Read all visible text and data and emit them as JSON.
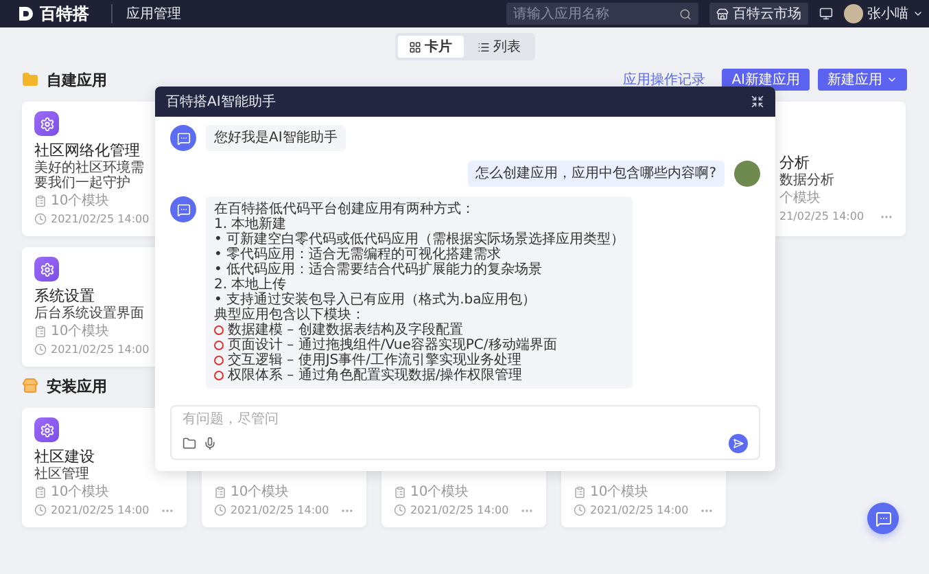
{
  "header": {
    "logo": "百特搭",
    "title": "应用管理",
    "search": {
      "placeholder": "请输入应用名称"
    },
    "market": "百特云市场",
    "user": "张小喵"
  },
  "view_toggle": [
    {
      "label": "卡片",
      "selected": true
    },
    {
      "label": "列表",
      "selected": false
    }
  ],
  "sections": [
    {
      "kind": "folder",
      "title": "自建应用",
      "actions": {
        "link": "应用操作记录",
        "ai_button": "AI新建应用",
        "new_button": "新建应用"
      },
      "cards": [
        {
          "kind": "full",
          "title": "社区网络化管理",
          "description": "美好的社区环境需要我们一起守护",
          "modules": "10个模块",
          "date": "2021/02/25 14:00"
        },
        {
          "kind": "covered"
        },
        {
          "kind": "covered"
        },
        {
          "kind": "covered"
        },
        {
          "kind": "right",
          "title": "分析",
          "description": "数据分析",
          "modules": "个模块",
          "date": "21/02/25 14:00"
        },
        {
          "kind": "full",
          "title": "系统设置",
          "description": "后台系统设置界面",
          "modules": "10个模块",
          "date": "2021/02/25 14:00"
        }
      ]
    },
    {
      "kind": "store",
      "title": "安装应用",
      "cards": [
        {
          "kind": "full",
          "title": "社区建设",
          "description": "社区管理",
          "modules": "10个模块",
          "date": "2021/02/25 14:00"
        },
        {
          "kind": "bottom",
          "modules": "10个模块",
          "date": "2021/02/25 14:00"
        },
        {
          "kind": "bottom",
          "modules": "10个模块",
          "date": "2021/02/25 14:00"
        },
        {
          "kind": "bottom",
          "modules": "10个模块",
          "date": "2021/02/25 14:00"
        }
      ]
    }
  ],
  "chat": {
    "title": "百特搭AI智能助手",
    "messages": [
      {
        "kind": "bot",
        "text": "您好我是AI智能助手"
      },
      {
        "kind": "user",
        "text": "怎么创建应用，应用中包含哪些内容啊?"
      },
      {
        "kind": "bot",
        "lines": [
          {
            "kind": "text",
            "text": "在百特搭低代码平台创建应用有两种方式："
          },
          {
            "kind": "text",
            "text": "1. 本地新建"
          },
          {
            "kind": "text",
            "text": "• 可新建空白零代码或低代码应用（需根据实际场景选择应用类型）"
          },
          {
            "kind": "text",
            "text": "• 零代码应用：适合无需编程的可视化搭建需求"
          },
          {
            "kind": "text",
            "text": "• 低代码应用：适合需要结合代码扩展能力的复杂场景"
          },
          {
            "kind": "text",
            "text": "2. 本地上传"
          },
          {
            "kind": "text",
            "text": "• 支持通过安装包导入已有应用（格式为.ba应用包）"
          },
          {
            "kind": "text",
            "text": "典型应用包含以下模块："
          },
          {
            "kind": "module",
            "text": "数据建模 – 创建数据表结构及字段配置"
          },
          {
            "kind": "module",
            "text": "页面设计 – 通过拖拽组件/Vue容器实现PC/移动端界面"
          },
          {
            "kind": "module",
            "text": "交互逻辑 – 使用JS事件/工作流引擎实现业务处理"
          },
          {
            "kind": "module",
            "text": "权限体系 – 通过角色配置实现数据/操作权限管理"
          }
        ]
      }
    ],
    "input": {
      "placeholder": "有问题，尽管问"
    }
  }
}
